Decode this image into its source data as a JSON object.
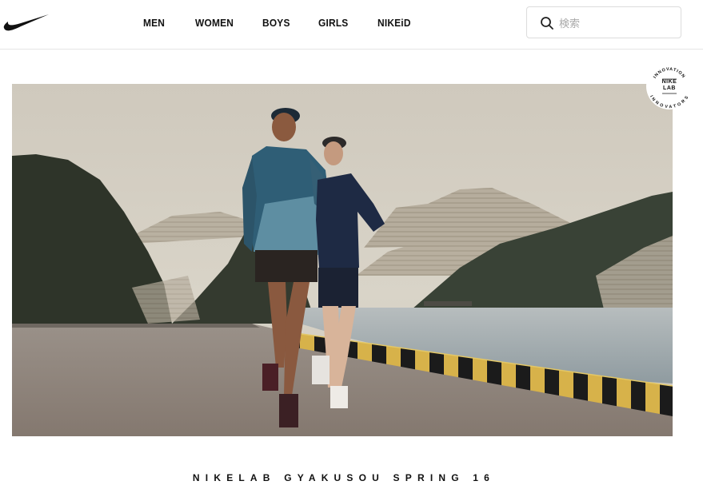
{
  "header": {
    "brand": "Nike",
    "nav": [
      {
        "id": "men",
        "label": "MEN"
      },
      {
        "id": "women",
        "label": "WOMEN"
      },
      {
        "id": "boys",
        "label": "BOYS"
      },
      {
        "id": "girls",
        "label": "GIRLS"
      },
      {
        "id": "nikeid",
        "label": "NIKEiD"
      }
    ],
    "search": {
      "placeholder": "検索",
      "value": "",
      "icon": "search-icon"
    }
  },
  "badge": {
    "top_arc": "INNOVATION",
    "line1": "NIKE",
    "line2": "LAB",
    "bottom_arc": "INNOVATORS"
  },
  "hero": {
    "alt_icon": "hero-photo"
  },
  "caption": "NIKELAB GYAKUSOU SPRING 16"
}
